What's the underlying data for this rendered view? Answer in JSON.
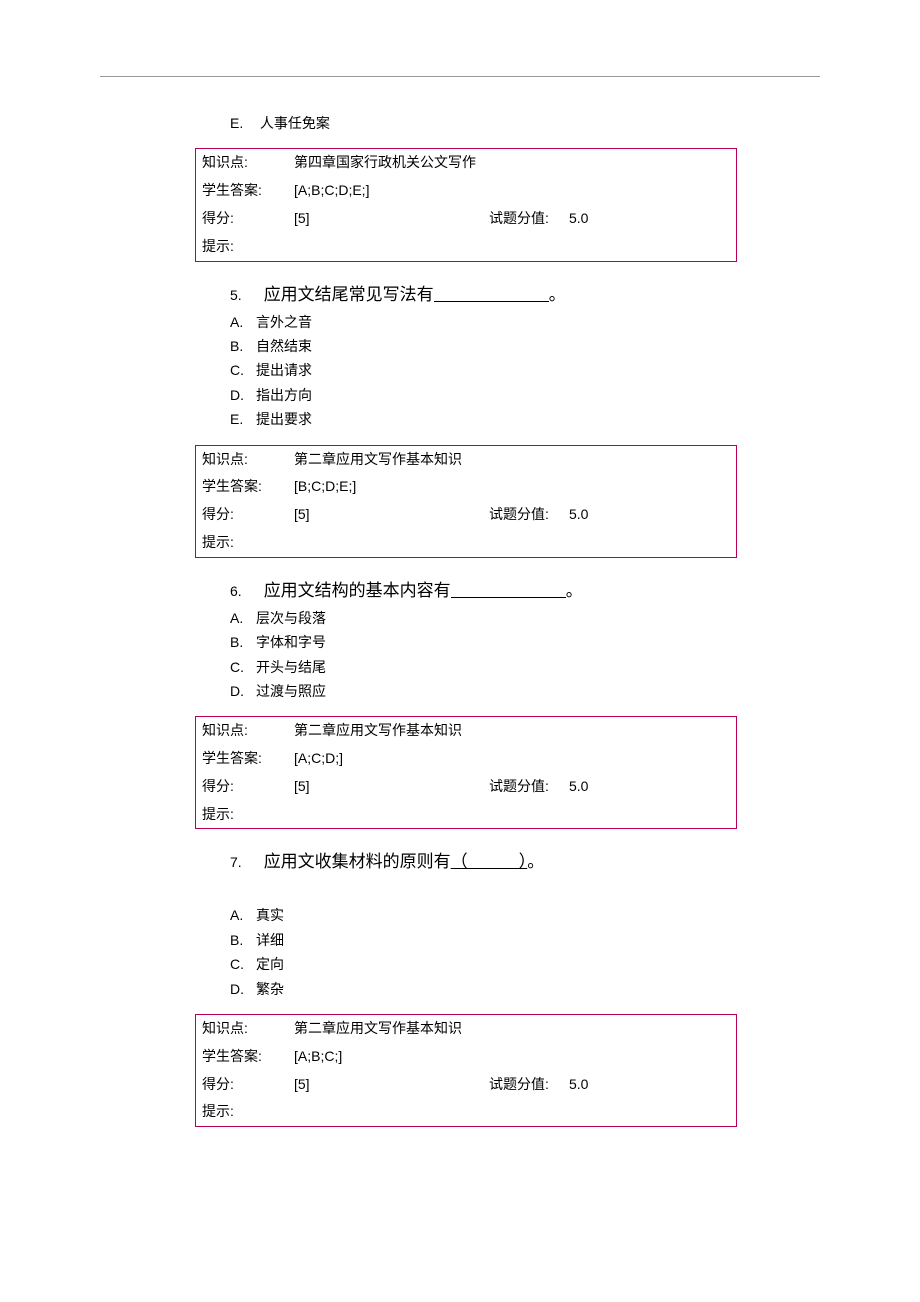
{
  "intro_option": {
    "letter": "E.",
    "text": "人事任免案"
  },
  "box1": {
    "kp_label": "知识点:",
    "kp_val": "第四章国家行政机关公文写作",
    "ans_label": "学生答案:",
    "ans_val": "[A;B;C;D;E;]",
    "score_label": "得分:",
    "score_val": "[5]",
    "max_label": "试题分值:",
    "max_val": "5.0",
    "hint_label": "提示:"
  },
  "q5": {
    "num": "5.",
    "text_before": "应用文结尾常见写法有",
    "text_after": "。",
    "options": [
      {
        "letter": "A.",
        "text": "言外之音"
      },
      {
        "letter": "B.",
        "text": "自然结束"
      },
      {
        "letter": "C.",
        "text": "提出请求"
      },
      {
        "letter": "D.",
        "text": "指出方向"
      },
      {
        "letter": "E.",
        "text": "提出要求"
      }
    ]
  },
  "box2": {
    "kp_label": "知识点:",
    "kp_val": "第二章应用文写作基本知识",
    "ans_label": "学生答案:",
    "ans_val": "[B;C;D;E;]",
    "score_label": "得分:",
    "score_val": "[5]",
    "max_label": "试题分值:",
    "max_val": "5.0",
    "hint_label": "提示:"
  },
  "q6": {
    "num": "6.",
    "text_before": "应用文结构的基本内容有",
    "text_after": "。",
    "options": [
      {
        "letter": "A.",
        "text": "层次与段落"
      },
      {
        "letter": "B.",
        "text": "字体和字号"
      },
      {
        "letter": "C.",
        "text": "开头与结尾"
      },
      {
        "letter": "D.",
        "text": "过渡与照应"
      }
    ]
  },
  "box3": {
    "kp_label": "知识点:",
    "kp_val": "第二章应用文写作基本知识",
    "ans_label": "学生答案:",
    "ans_val": "[A;C;D;]",
    "score_label": "得分:",
    "score_val": "[5]",
    "max_label": "试题分值:",
    "max_val": "5.0",
    "hint_label": "提示:"
  },
  "q7": {
    "num": "7.",
    "text_before": "应用文收集材料的原则有",
    "paren": "（　　　）",
    "text_after": "。",
    "options": [
      {
        "letter": "A.",
        "text": "真实"
      },
      {
        "letter": "B.",
        "text": "详细"
      },
      {
        "letter": "C.",
        "text": "定向"
      },
      {
        "letter": "D.",
        "text": "繁杂"
      }
    ]
  },
  "box4": {
    "kp_label": "知识点:",
    "kp_val": "第二章应用文写作基本知识",
    "ans_label": "学生答案:",
    "ans_val": "[A;B;C;]",
    "score_label": "得分:",
    "score_val": "[5]",
    "max_label": "试题分值:",
    "max_val": "5.0",
    "hint_label": "提示:"
  }
}
